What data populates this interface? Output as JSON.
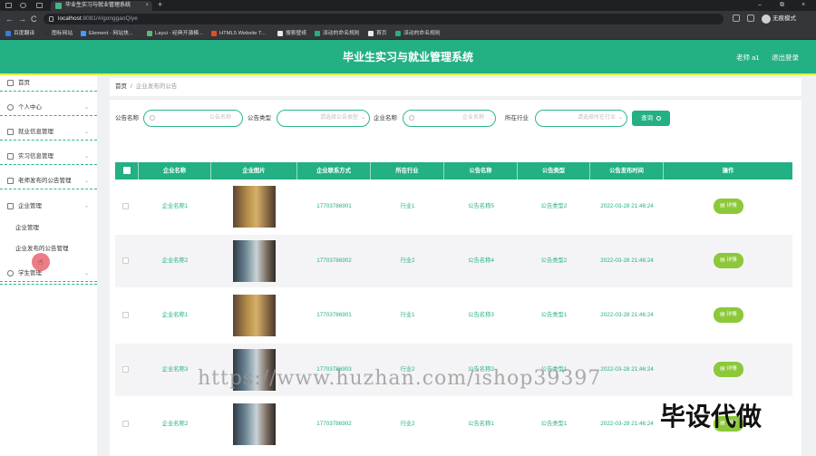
{
  "browser": {
    "tab_title": "毕业生实习与就业管理系统",
    "close_glyph": "×",
    "new_tab_glyph": "+",
    "back_glyph": "←",
    "forward_glyph": "→",
    "reload_glyph": "C",
    "url_host": "localhost",
    "url_path": ":8081/#/gonggaoQiye",
    "profile_label": "无痕模式",
    "window_minimize": "–",
    "window_restore": "⧉",
    "window_close": "×",
    "bookmarks": [
      {
        "label": "百度翻译",
        "color": "#3b7bdc"
      },
      {
        "label": "图标网站",
        "color": "#333333"
      },
      {
        "label": "Element - 网站快...",
        "color": "#409eff"
      },
      {
        "label": "Layui - 经典开源模...",
        "color": "#5fb878"
      },
      {
        "label": "HTML5 Website T...",
        "color": "#e44d26"
      },
      {
        "label": "搜索壁纸",
        "color": "#e9e9e9"
      },
      {
        "label": "派动的命名规则",
        "color": "#22b084"
      },
      {
        "label": "首页",
        "color": "#e9e9e9"
      },
      {
        "label": "派动的命名规则",
        "color": "#22b084"
      }
    ]
  },
  "header": {
    "title": "毕业生实习与就业管理系统",
    "user": "老师 a1",
    "logout": "退出登录"
  },
  "sidebar": {
    "items": [
      {
        "label": "首页",
        "icon": "home-icon"
      },
      {
        "label": "个人中心",
        "icon": "user-icon"
      },
      {
        "label": "就业信息管理",
        "icon": "briefcase-icon"
      },
      {
        "label": "实习信息管理",
        "icon": "mail-icon"
      },
      {
        "label": "老师发布的公告管理",
        "icon": "edit-icon"
      },
      {
        "label": "企业管理",
        "icon": "building-icon"
      },
      {
        "label": "学生管理",
        "icon": "student-icon"
      }
    ],
    "chevron_glyph": "⌄",
    "submenu": [
      "企业管理",
      "企业发布的公告管理"
    ]
  },
  "breadcrumb": {
    "home": "首页",
    "separator": "/",
    "current": "企业发布的公告"
  },
  "filters": {
    "label_1": "公告名称",
    "placeholder_1": "公告名称",
    "label_2": "公告类型",
    "placeholder_2": "请选择公告类型",
    "label_3": "企业名称",
    "placeholder_3": "企业名称",
    "label_4": "所在行业",
    "placeholder_4": "请选择所在行业",
    "dropdown_glyph": "⌄",
    "search_button": "查询"
  },
  "table": {
    "headers": [
      "企业名称",
      "企业图片",
      "企业联系方式",
      "所在行业",
      "公告名称",
      "公告类型",
      "公告发布时间",
      "操作"
    ],
    "detail_label": "详情",
    "rows": [
      {
        "company": "企业名称1",
        "phone": "17703786901",
        "industry": "行业1",
        "notice": "公告名称5",
        "type": "公告类型2",
        "time": "2022-03-28 21:46:24"
      },
      {
        "company": "企业名称2",
        "phone": "17703786902",
        "industry": "行业2",
        "notice": "公告名称4",
        "type": "公告类型2",
        "time": "2022-03-28 21:46:24"
      },
      {
        "company": "企业名称1",
        "phone": "17703786901",
        "industry": "行业1",
        "notice": "公告名称3",
        "type": "公告类型1",
        "time": "2022-03-28 21:46:24"
      },
      {
        "company": "企业名称3",
        "phone": "17703786903",
        "industry": "行业2",
        "notice": "公告名称2",
        "type": "公告类型1",
        "time": "2022-03-28 21:46:24"
      },
      {
        "company": "企业名称2",
        "phone": "17703786902",
        "industry": "行业2",
        "notice": "公告名称1",
        "type": "公告类型1",
        "time": "2022-03-28 21:46:24"
      }
    ]
  },
  "overlay": {
    "watermark": "https://www.huzhan.com/ishop39397",
    "promo": "毕设代做"
  }
}
